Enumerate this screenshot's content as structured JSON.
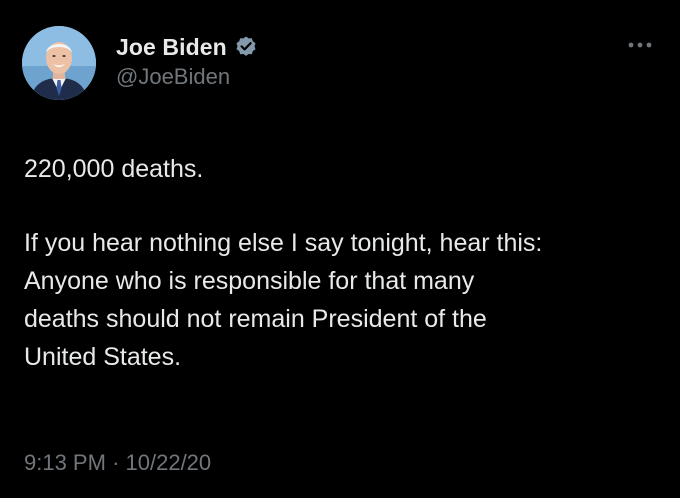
{
  "author": {
    "display_name": "Joe Biden",
    "handle": "@JoeBiden",
    "verified": true,
    "avatar_icon": "avatar-photo",
    "verified_icon": "verified-badge-icon",
    "verified_color": "#829aab"
  },
  "menu": {
    "icon": "more-options-icon"
  },
  "tweet": {
    "paragraph_1": "220,000 deaths.",
    "paragraph_2": "If you hear nothing else I say tonight, hear this:\nAnyone who is responsible for that many\ndeaths should not remain President of the\nUnited States.",
    "time": "9:13 PM",
    "separator": "·",
    "date": "10/22/20"
  },
  "colors": {
    "background": "#000000",
    "text_primary": "#e7e9ea",
    "text_secondary": "#71767b"
  }
}
